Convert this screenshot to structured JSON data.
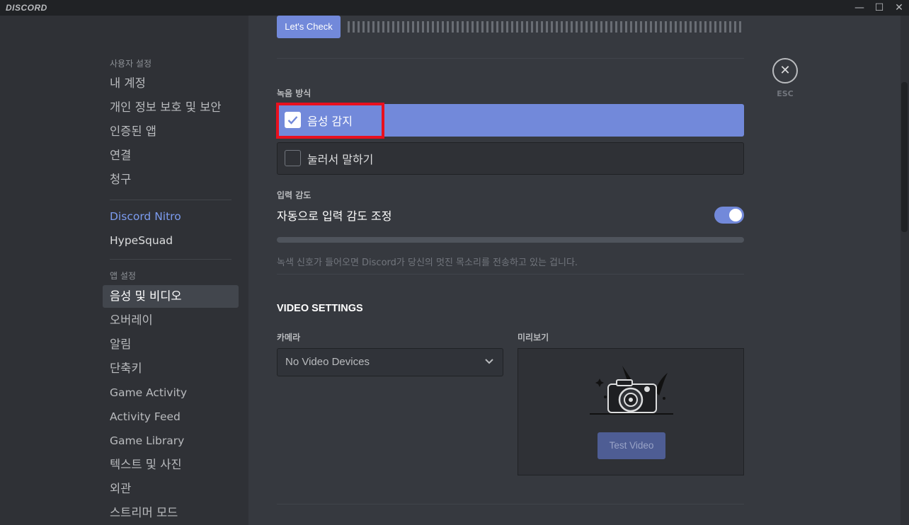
{
  "window": {
    "brand": "DISCORD",
    "minimize": "—",
    "maximize": "☐",
    "close": "✕"
  },
  "sidebar": {
    "user_category": "사용자 설정",
    "user_items": [
      "내 계정",
      "개인 정보 보호 및 보안",
      "인증된 앱",
      "연결",
      "청구"
    ],
    "nitro": "Discord Nitro",
    "hypesquad": "HypeSquad",
    "app_category": "앱 설정",
    "app_items": [
      "음성 및 비디오",
      "오버레이",
      "알림",
      "단축키",
      "Game Activity",
      "Activity Feed",
      "Game Library",
      "텍스트 및 사진",
      "외관",
      "스트리머 모드"
    ],
    "selected": "음성 및 비디오"
  },
  "voice": {
    "check_button": "Let's Check",
    "input_mode_label": "녹음 방식",
    "voice_activity": "음성 감지",
    "push_to_talk": "눌러서 말하기",
    "sensitivity_label": "입력 감도",
    "auto_sensitivity": "자동으로 입력 감도 조정",
    "auto_sensitivity_enabled": true,
    "note": "녹색 신호가 들어오면 Discord가 당신의 멋진 목소리를 전송하고 있는 겁니다."
  },
  "video": {
    "heading": "VIDEO SETTINGS",
    "camera_label": "카메라",
    "camera_value": "No Video Devices",
    "preview_label": "미리보기",
    "test_button": "Test Video"
  },
  "close": {
    "label": "ESC"
  },
  "colors": {
    "accent": "#7289da",
    "highlight": "#e8101e",
    "background": "#36393f",
    "sidebar": "#2f3136"
  }
}
